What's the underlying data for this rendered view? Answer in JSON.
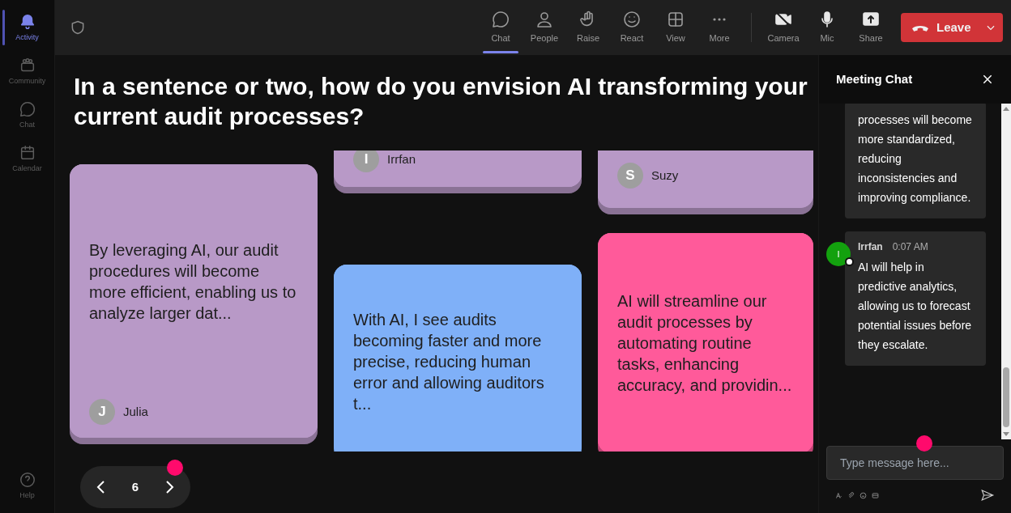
{
  "sidebar": {
    "items": [
      {
        "label": "Activity",
        "selected": true
      },
      {
        "label": "Community",
        "selected": false
      },
      {
        "label": "Chat",
        "selected": false
      },
      {
        "label": "Calendar",
        "selected": false
      }
    ],
    "help": {
      "label": "Help"
    }
  },
  "toolbar": {
    "items": [
      {
        "label": "Chat",
        "selected": true
      },
      {
        "label": "People",
        "selected": false
      },
      {
        "label": "Raise",
        "selected": false
      },
      {
        "label": "React",
        "selected": false
      },
      {
        "label": "View",
        "selected": false
      },
      {
        "label": "More",
        "selected": false
      }
    ],
    "devices": [
      {
        "label": "Camera"
      },
      {
        "label": "Mic"
      },
      {
        "label": "Share"
      }
    ],
    "leave": {
      "label": "Leave"
    }
  },
  "question": "In a sentence or two, how do you envision AI transforming your current audit processes?",
  "board": {
    "columns": [
      [
        {
          "text": "By leveraging AI, our audit procedures will become more efficient, enabling us to analyze larger dat...",
          "author": "Julia",
          "initial": "J",
          "color": "#b899c7"
        }
      ],
      [
        {
          "author": "Irrfan",
          "initial": "I",
          "color": "#b899c7"
        },
        {
          "text": "With AI, I see audits becoming faster and more precise, reducing human error and allowing auditors t...",
          "color": "#7fb0f8"
        }
      ],
      [
        {
          "author": "Suzy",
          "initial": "S",
          "color": "#b899c7"
        },
        {
          "text": "AI will streamline our audit processes by automating routine tasks, enhancing accuracy, and providin...",
          "color": "#ff5a9a"
        }
      ]
    ]
  },
  "pagination": {
    "page": "6"
  },
  "chat": {
    "title": "Meeting Chat",
    "messages": [
      {
        "text": "processes will become more standardized, reducing inconsistencies and improving compliance."
      },
      {
        "author": "Irrfan",
        "initial": "I",
        "time": "0:07 AM",
        "text": "AI will help in predictive analytics, allowing us to forecast potential issues before they escalate."
      }
    ],
    "placeholder": "Type message here..."
  }
}
